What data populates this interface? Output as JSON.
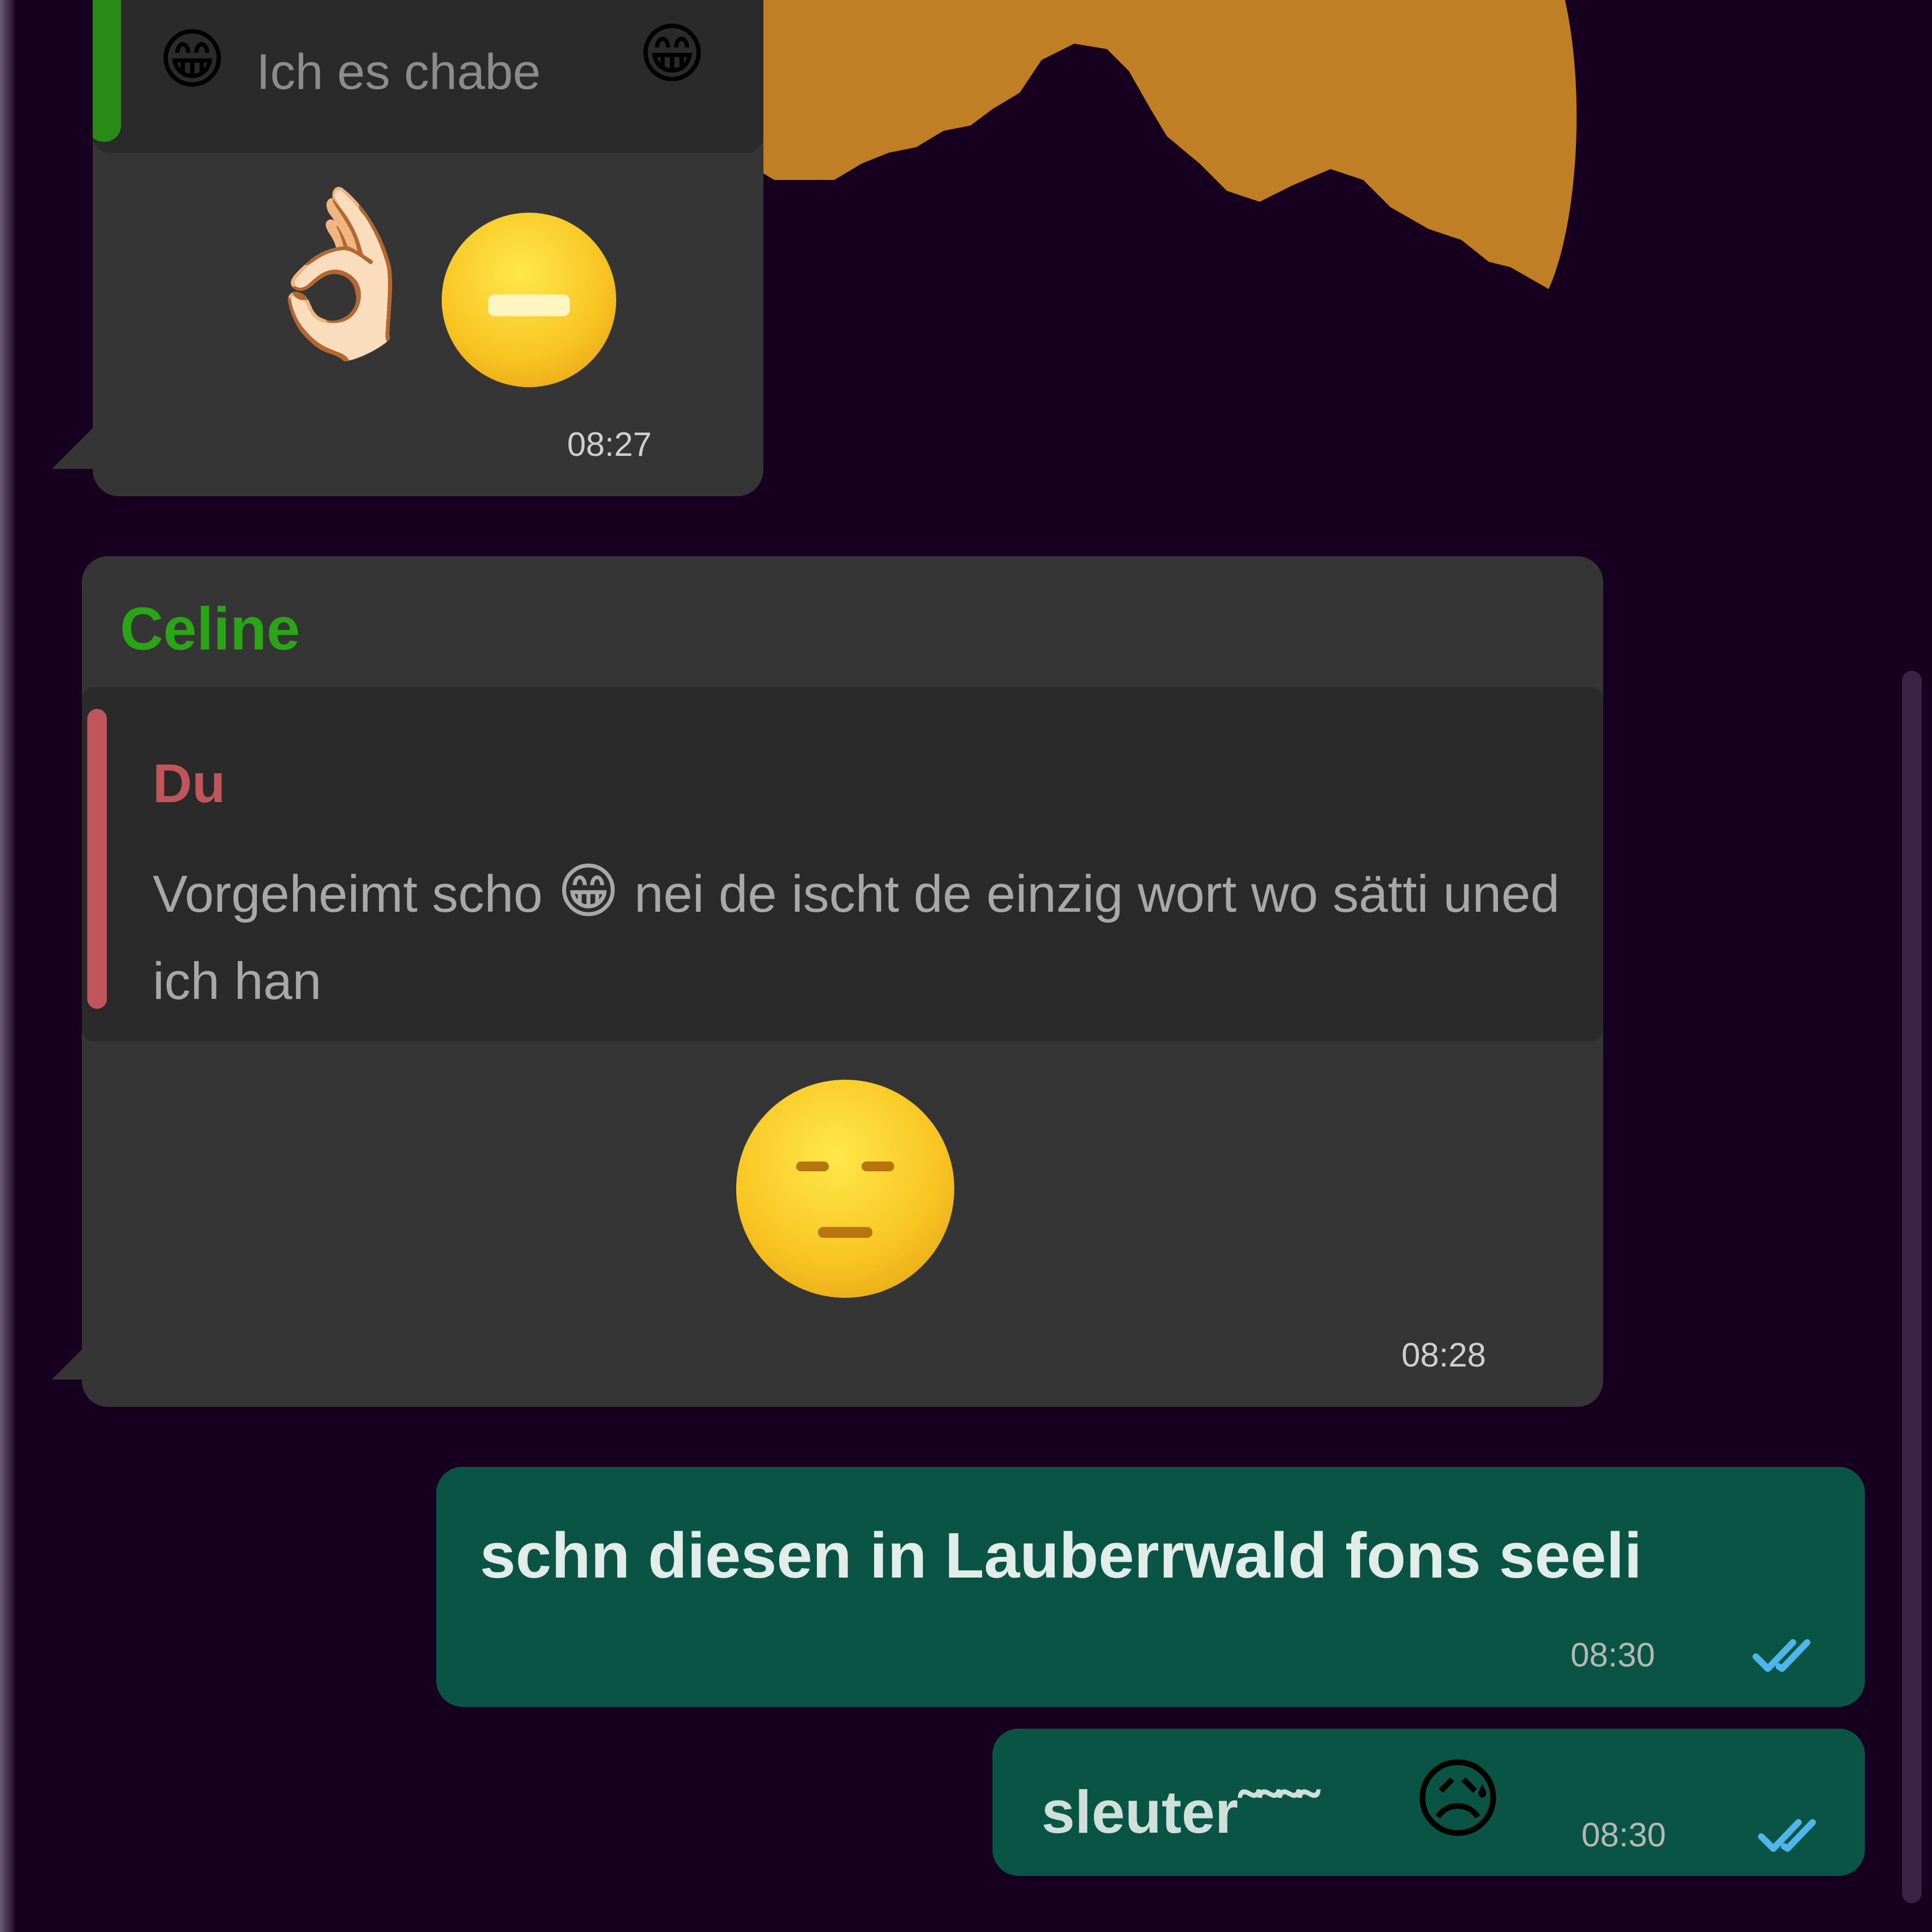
{
  "colors": {
    "background": "#17001f",
    "incoming_bubble": "#353535",
    "outgoing_bubble": "#0a5446",
    "quote_background": "#2a2a2a",
    "sender_name": "#2aa516",
    "quote_author": "#c0565b",
    "wallpaper_accent": "#c07f24",
    "read_ticks": "#4fb6ec"
  },
  "messages": [
    {
      "direction": "incoming",
      "quote": {
        "text": "Ich es chabe",
        "emoji_left": "😁",
        "emoji_right": "😁"
      },
      "emojis": [
        "👌🏻",
        "😁"
      ],
      "time": "08:27"
    },
    {
      "direction": "incoming",
      "sender": "Celine",
      "quote": {
        "author": "Du",
        "text_before": "Vorgeheimt scho",
        "emoji": "😁",
        "text_after": "nei de ischt de einzig wort wo sätti uned ich han"
      },
      "emojis": [
        "😒"
      ],
      "time": "08:28"
    },
    {
      "direction": "outgoing",
      "text": "schn diesen in Lauberrwald fons seeli",
      "time": "08:30",
      "ticks": "read-ticks-icon"
    },
    {
      "direction": "outgoing",
      "text": "sleuter˜˜˜˜",
      "emoji": "😥",
      "time": "08:30",
      "ticks": "read-ticks-icon"
    }
  ]
}
